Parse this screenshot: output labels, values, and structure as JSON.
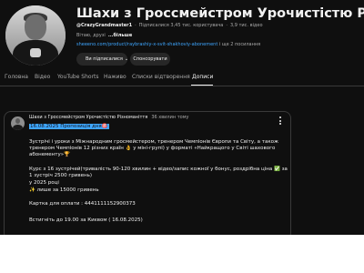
{
  "channel": {
    "title": "Шахи з Гроссмейстром Урочистістю Різноманіття",
    "handle": "@CrazyGrandmaster1",
    "subscribers": "Підписалися 3,45 тис. користувача",
    "videos": "3,9 тис. відео",
    "description": "Вітаю, друзі",
    "more_label": "...більше",
    "link": "sheeeno.com/product/raybrashiy-x-svit-shakhoviy-abonement",
    "link_extra": "і ще 2 посилання",
    "subscribe_label": "Ви підписалися",
    "subscribe_chevron": "⌄",
    "sponsor_label": "Спонсорувати"
  },
  "tabs": [
    "Головна",
    "Відео",
    "YouTube Shorts",
    "Наживо",
    "Списки відтворення",
    "Дописи"
  ],
  "post": {
    "author": "Шахи з Гроссмейстром Урочистістю Різноманіття",
    "time": "36 хвилин тому",
    "title": "16.08.2025 Пропозиція дня🎯",
    "lines": [
      "Зустрічі і уроки з Міжнародним гросмейстером, тренером Чемпіонів Європи та Світу, а також",
      "тренером Чемпіонів 12 різних країн 👌 у міні-групі) у форматі «Найкращого у Світі шахового",
      "абонементу»🏆",
      "",
      "Курс з 16 зустрічей(тривалість 90-120 хвилин + відео/запис кожної у бонус, роздрібна ціна ✅ за",
      "1 зустріч 2500 гривень)",
      "у 2025 році",
      "✨ лише за 15000 гривень",
      "",
      "Картка для оплати : 4441111152900373",
      "",
      "Встигніть до 19.00 за Києвом ( 16.08.2025)"
    ]
  }
}
